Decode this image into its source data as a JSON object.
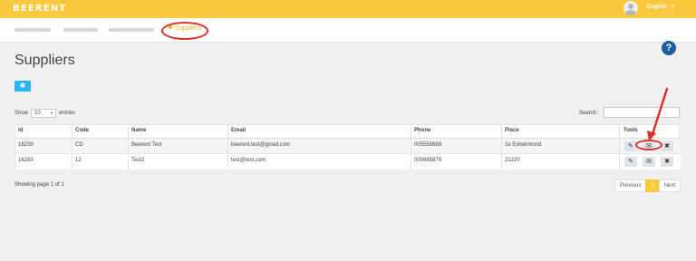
{
  "app": {
    "logo": "BEERENT"
  },
  "topbar": {
    "language": "English",
    "language_caret": "▼"
  },
  "breadcrumb": {
    "active": "Suppliers"
  },
  "header": {
    "title": "Suppliers",
    "add_icon": "gear-icon",
    "help_icon": "question-icon"
  },
  "entries": {
    "show_label": "Show",
    "value": "10",
    "caret": "▾",
    "suffix": "entries"
  },
  "search": {
    "label": "Search :",
    "value": ""
  },
  "table": {
    "columns": [
      "Id",
      "Code",
      "Name",
      "Email",
      "Phone",
      "Place",
      "Tools"
    ],
    "rows": [
      {
        "id": "16239",
        "code": "CD",
        "name": "Beerent Test",
        "email": "beerent.test@gmail.com",
        "phone": "005558889",
        "place": "1e Exloërmond"
      },
      {
        "id": "16283",
        "code": "12",
        "name": "Test2",
        "email": "test@test.com",
        "phone": "000665879",
        "place": "21220"
      }
    ],
    "tools": {
      "edit_glyph": "✎",
      "mail_glyph": "✉",
      "delete_glyph": "✖"
    }
  },
  "footer": {
    "info": "Showing page 1 of 1"
  },
  "pagination": {
    "previous": "Previous",
    "current": "1",
    "next": "Next"
  },
  "colors": {
    "topbar": "#fbc93d",
    "accent_blue": "#29b6f6",
    "annotation_red": "#d9342b",
    "help_blue": "#1f5e9e"
  }
}
